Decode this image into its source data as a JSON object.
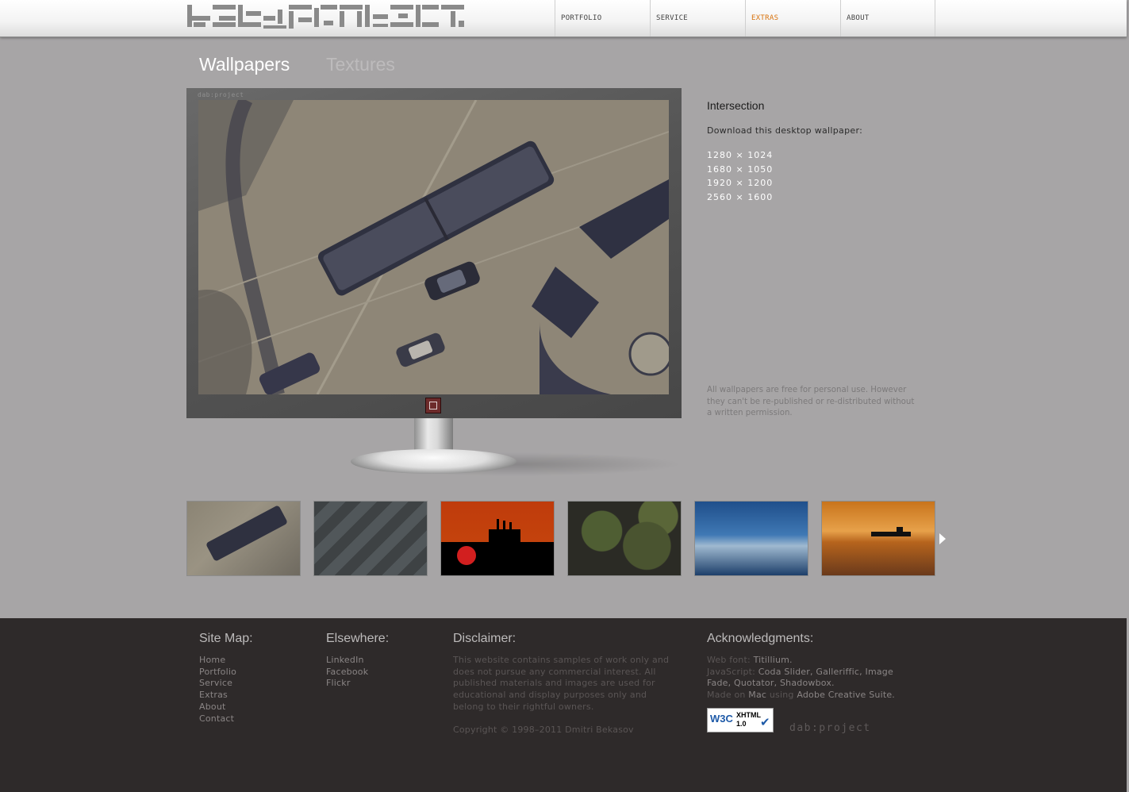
{
  "header": {
    "logo_alt": "dab:project",
    "nav": [
      {
        "label": "PORTFOLIO",
        "active": false
      },
      {
        "label": "SERVICE",
        "active": false
      },
      {
        "label": "EXTRAS",
        "active": true
      },
      {
        "label": "ABOUT",
        "active": false
      }
    ]
  },
  "tabs": [
    {
      "label": "Wallpapers",
      "active": true
    },
    {
      "label": "Textures",
      "active": false
    }
  ],
  "monitor": {
    "brand": "dab:project"
  },
  "wallpaper": {
    "title": "Intersection",
    "download_label": "Download this desktop wallpaper:",
    "resolutions": [
      "1280 × 1024",
      "1680 × 1050",
      "1920 × 1200",
      "2560 × 1600"
    ],
    "note": "All wallpapers are free for personal use. However they can't be re-published or re-distributed without a written permission."
  },
  "footer": {
    "sitemap": {
      "heading": "Site Map:",
      "links": [
        "Home",
        "Portfolio",
        "Service",
        "Extras",
        "About",
        "Contact"
      ]
    },
    "elsewhere": {
      "heading": "Elsewhere:",
      "links": [
        "LinkedIn",
        "Facebook",
        "Flickr"
      ]
    },
    "disclaimer": {
      "heading": "Disclaimer:",
      "text": "This website contains samples of work only and does not pursue any commercial interest. All published materials and images are used for educational and display purposes only and belong to their rightful owners.",
      "copyright": "Copyright © 1998–2011 Dmitri Bekasov"
    },
    "ack": {
      "heading": "Acknowledgments:",
      "webfont_label": "Web font:",
      "webfont": "Titillium.",
      "js_label": "JavaScript:",
      "js": "Coda Slider, Galleriffic, Image Fade, Quotator, Shadowbox.",
      "made_label": "Made on",
      "mac": "Mac",
      "using_label": "using",
      "suite": "Adobe Creative Suite."
    },
    "badge": {
      "w3c": "W3C",
      "xhtml": "XHTML",
      "version": "1.0"
    },
    "logo": "dab:project"
  },
  "colors": {
    "accent": "#d9730d",
    "background": "#a7a5a6",
    "footer": "#2e2a2a"
  }
}
